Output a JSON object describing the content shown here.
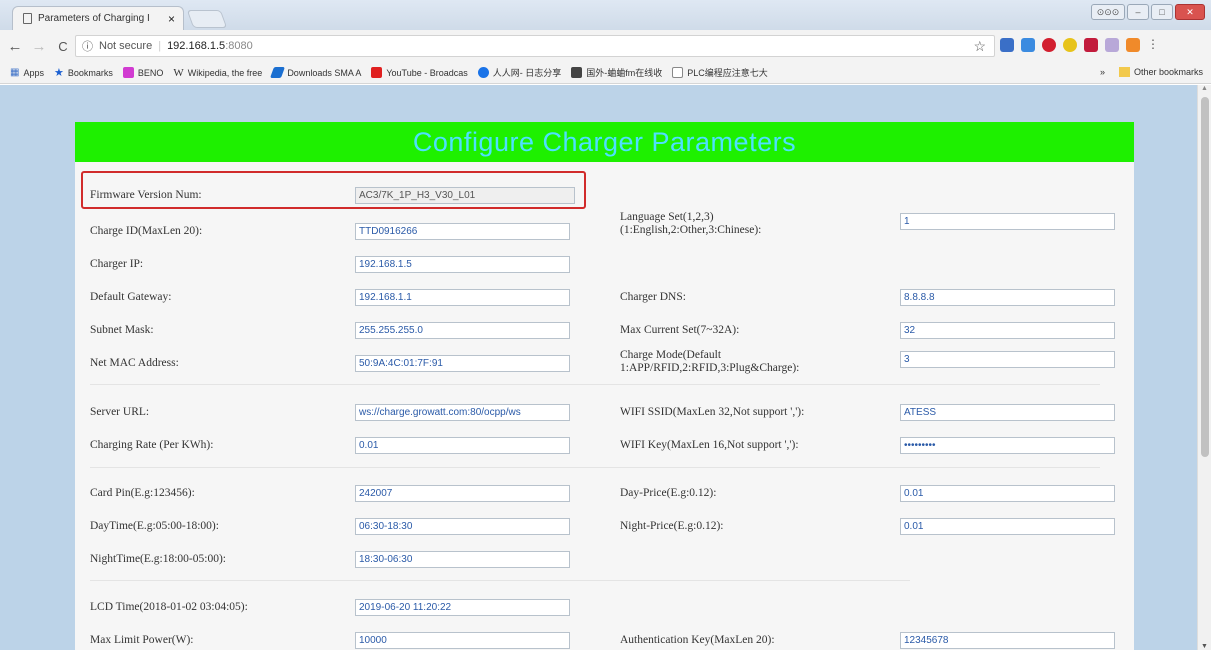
{
  "browser": {
    "tab_title": "Parameters of Charging I",
    "tab_close": "×",
    "security_label": "Not secure",
    "url_host": "192.168.1.5",
    "url_port": ":8080",
    "win_min": "–",
    "win_max": "□",
    "win_close": "✕",
    "win_user": "⊙⊙⊙"
  },
  "bookmarks": {
    "apps": "Apps",
    "items": [
      "Bookmarks",
      "BENO",
      "Wikipedia, the free",
      "Downloads SMA A",
      "YouTube - Broadcas",
      "人人网- 日志分享",
      "国外-蛐蛐fm在线收",
      "PLC编程应注意七大"
    ],
    "overflow": "»",
    "other": "Other bookmarks",
    "colors": [
      "#d13bd1",
      "#555555",
      "#1b6fd1",
      "#e02020",
      "#1a73e8",
      "#444444",
      "#888888"
    ]
  },
  "page": {
    "banner_title": "Configure Charger Parameters",
    "banner_color": "#1ef000",
    "fields_left": [
      {
        "label": "Firmware Version Num:",
        "value": "AC3/7K_1P_H3_V30_L01",
        "readonly": true
      },
      {
        "label": "Charge ID(MaxLen 20):",
        "value": "TTD0916266"
      },
      {
        "label": "Charger IP:",
        "value": "192.168.1.5"
      },
      {
        "label": "Default Gateway:",
        "value": "192.168.1.1"
      },
      {
        "label": "Subnet Mask:",
        "value": "255.255.255.0"
      },
      {
        "label": "Net MAC Address:",
        "value": "50:9A:4C:01:7F:91"
      },
      {
        "label": "Server URL:",
        "value": "ws://charge.growatt.com:80/ocpp/ws"
      },
      {
        "label": "Charging Rate (Per KWh):",
        "value": "0.01"
      },
      {
        "label": "Card Pin(E.g:123456):",
        "value": "242007"
      },
      {
        "label": "DayTime(E.g:05:00-18:00):",
        "value": "06:30-18:30"
      },
      {
        "label": "NightTime(E.g:18:00-05:00):",
        "value": "18:30-06:30"
      },
      {
        "label": "LCD Time(2018-01-02 03:04:05):",
        "value": "2019-06-20 11:20:22"
      },
      {
        "label": "Max Limit Power(W):",
        "value": "10000"
      }
    ],
    "fields_right": [
      {
        "label": "Language Set(1,2,3)",
        "label2": "(1:English,2:Other,3:Chinese):",
        "value": "1"
      },
      {
        "label": "Charger DNS:",
        "value": "8.8.8.8"
      },
      {
        "label": "Max Current Set(7~32A):",
        "value": "32"
      },
      {
        "label": "Charge Mode(Default",
        "label2": "1:APP/RFID,2:RFID,3:Plug&Charge):",
        "value": "3"
      },
      {
        "label": "WIFI SSID(MaxLen 32,Not support ','):",
        "value": "ATESS"
      },
      {
        "label": "WIFI Key(MaxLen 16,Not support ','):",
        "value": "•••••••••"
      },
      {
        "label": "Day-Price(E.g:0.12):",
        "value": "0.01"
      },
      {
        "label": "Night-Price(E.g:0.12):",
        "value": "0.01"
      },
      {
        "label": "Authentication Key(MaxLen 20):",
        "value": "12345678"
      }
    ]
  }
}
